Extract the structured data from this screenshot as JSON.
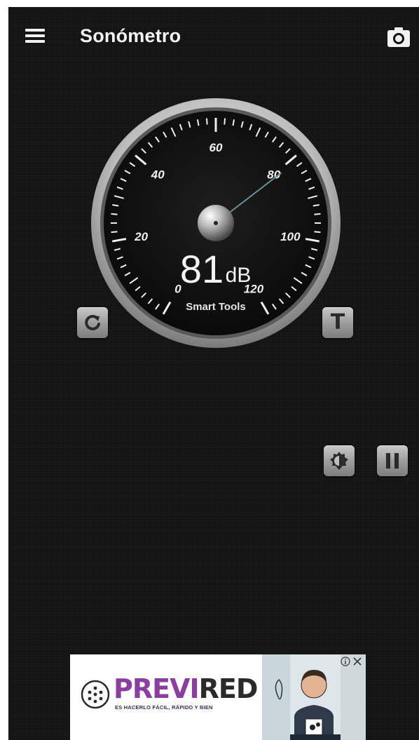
{
  "app": {
    "title": "Sonómetro"
  },
  "toolbar": {
    "menu_icon": "hamburger-menu-icon",
    "camera_icon": "camera-icon"
  },
  "gauge": {
    "reading": "81",
    "unit": "dB",
    "brand": "Smart Tools",
    "needle_value": 81,
    "scale": {
      "min": 0,
      "max": 120,
      "labels": [
        "0",
        "20",
        "40",
        "60",
        "80",
        "100",
        "120"
      ]
    }
  },
  "controls": {
    "reset_icon": "refresh-icon",
    "t_label": "T",
    "brightness_icon": "brightness-icon",
    "pause_icon": "pause-icon"
  },
  "ad": {
    "brand_part1": "PREVI",
    "brand_part2": "RED",
    "tagline": "ES HACERLO FÁCIL, RÁPIDO Y BIEN",
    "colors": {
      "brand_purple": "#8a3fa0",
      "brand_dark": "#2a2a2a"
    }
  },
  "colors": {
    "background": "#131313",
    "text": "#f4f4f4",
    "needle": "#6f8f95"
  }
}
